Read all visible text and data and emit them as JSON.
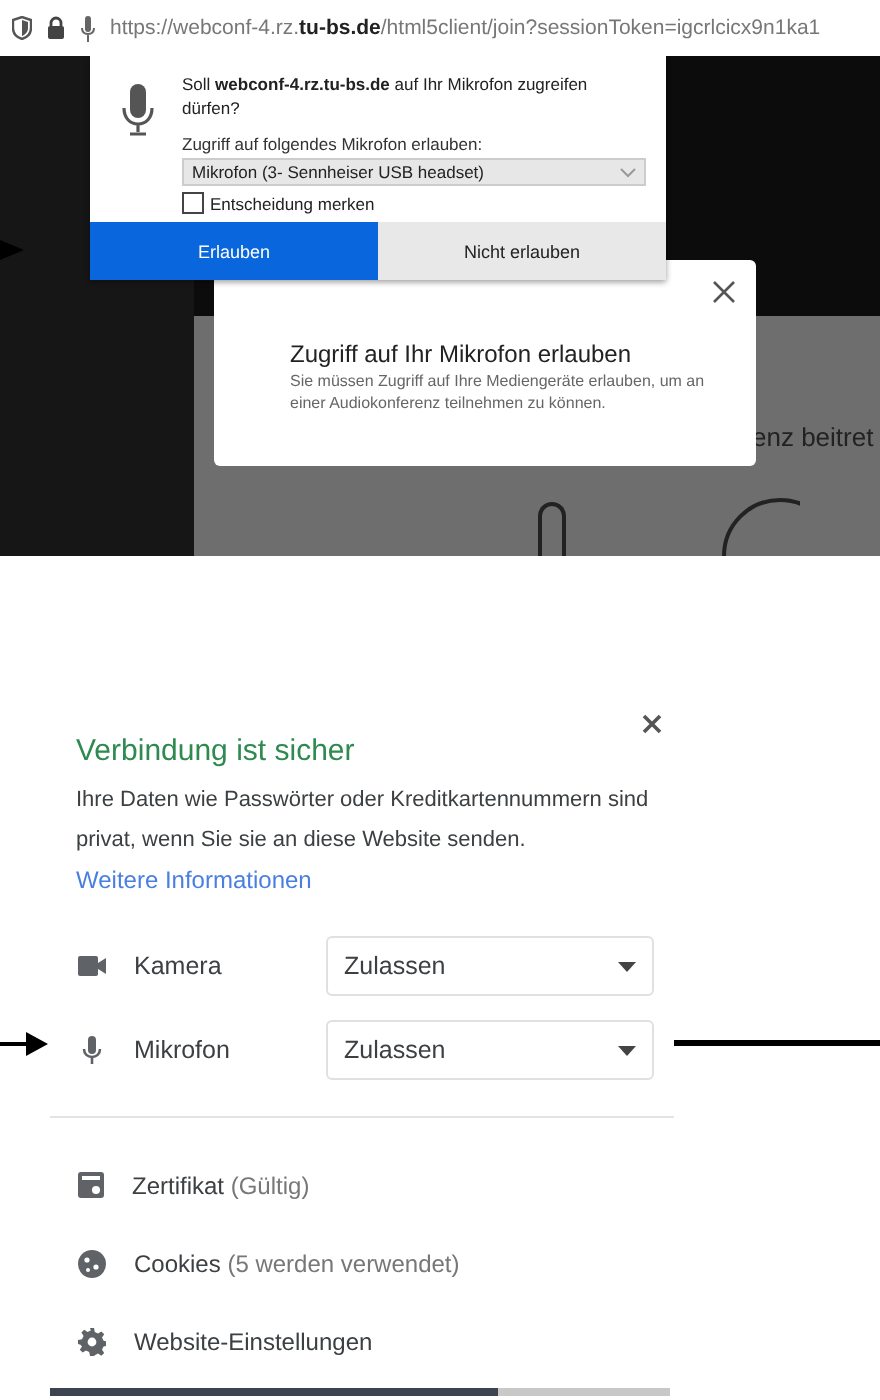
{
  "browser_bar": {
    "url": "https://webconf-4.rz.**tu-bs.de**/html5client/join?sessionToken=igcrlcicx9n1ka1"
  },
  "permission_prompt": {
    "question": "Soll **webconf-4.rz.tu-bs.de** auf Ihr Mikrofon zugreifen dürfen?",
    "device_label": "Zugriff auf folgendes Mikrofon erlauben:",
    "device": "Mikrofon (3- Sennheiser USB headset)",
    "remember": {
      "label": "Entscheidung merken",
      "checked": false
    },
    "buttons": [
      {
        "label": "Erlauben",
        "kind": "primary"
      },
      {
        "label": "Nicht erlauben",
        "kind": "secondary"
      }
    ]
  },
  "page_dialog": {
    "title": "Zugriff auf Ihr Mikrofon erlauben",
    "text": "Sie müssen Zugriff auf Ihre Mediengeräte erlauben, um an einer Audiokonferenz teilnehmen zu können."
  },
  "background_text": "enz beitret",
  "site_info": {
    "title": "Verbindung ist sicher",
    "description": "Ihre Daten wie Passwörter oder Kreditkartennummern sind privat, wenn Sie sie an diese Website senden.",
    "link": "Weitere Informationen",
    "permissions": [
      {
        "kind": "camera",
        "name": "Kamera",
        "value": "Zulassen"
      },
      {
        "kind": "microphone",
        "name": "Mikrofon",
        "value": "Zulassen"
      }
    ],
    "items": [
      {
        "kind": "certificate",
        "label": "Zertifikat",
        "note": "(Gültig)"
      },
      {
        "kind": "cookies",
        "label": "Cookies",
        "note": "(5 werden verwendet)"
      },
      {
        "kind": "settings",
        "label": "Website-Einstellungen"
      }
    ]
  }
}
